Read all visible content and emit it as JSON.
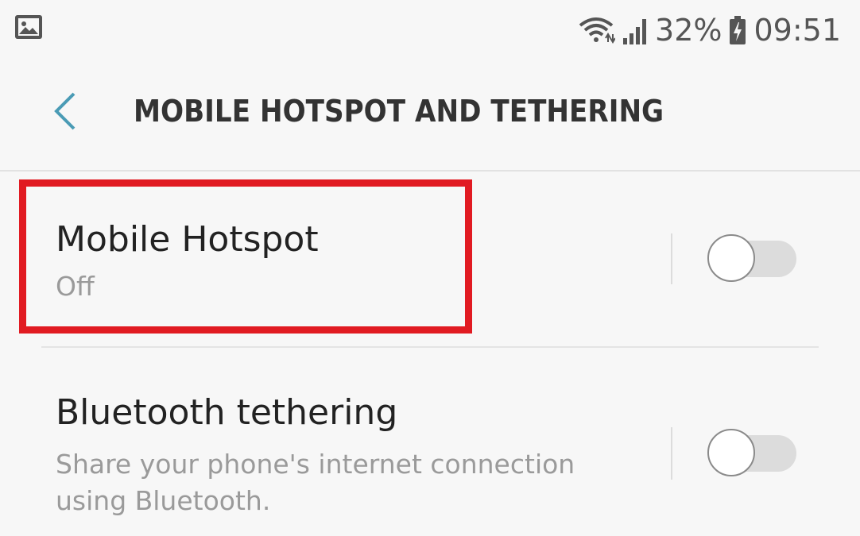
{
  "status_bar": {
    "battery_percent": "32%",
    "time": "09:51",
    "icons": [
      "gallery-icon",
      "wifi-icon",
      "signal-icon",
      "battery-charging-icon"
    ]
  },
  "header": {
    "back_icon": "chevron-left-icon",
    "title": "MOBILE HOTSPOT AND TETHERING"
  },
  "settings": [
    {
      "title": "Mobile Hotspot",
      "summary": "Off",
      "toggle_on": false
    },
    {
      "title": "Bluetooth tethering",
      "summary": "Share your phone's internet connection using Bluetooth.",
      "toggle_on": false
    }
  ],
  "colors": {
    "background": "#f7f7f7",
    "accent_back": "#4a9bb5",
    "highlight": "#e11b22"
  }
}
